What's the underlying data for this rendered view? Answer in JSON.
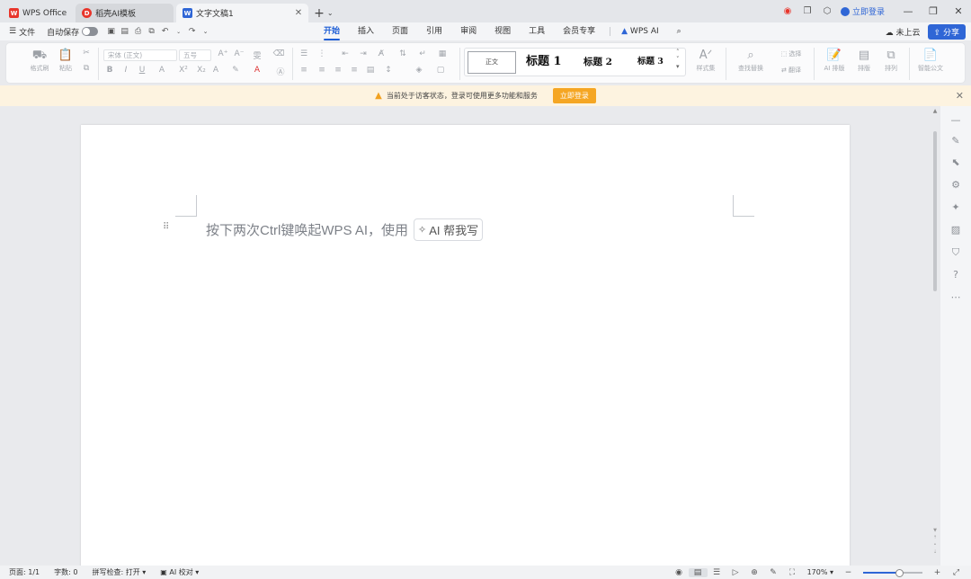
{
  "titlebar": {
    "tabs": [
      {
        "label": "WPS Office",
        "icon": "wps-logo-icon"
      },
      {
        "label": "稻壳AI模板",
        "icon": "docer-icon"
      },
      {
        "label": "文字文稿1",
        "icon": "word-doc-icon"
      }
    ],
    "new_tab": "+",
    "login_label": "立即登录"
  },
  "menu": {
    "file_label": "文件",
    "autosave_label": "自动保存",
    "tabs": [
      "开始",
      "插入",
      "页面",
      "引用",
      "审阅",
      "视图",
      "工具",
      "会员专享",
      "WPS AI"
    ],
    "active_tab": "开始",
    "cloud_label": "未上云",
    "share_label": "分享"
  },
  "ribbon": {
    "format_painter": "格式刷",
    "paste": "粘贴",
    "font_name": "宋体 (正文)",
    "font_size": "五号",
    "styles": [
      "正文",
      "标题 1",
      "标题 2",
      "标题 3"
    ],
    "style_set": "样式集",
    "find_replace": "查找替换",
    "select": "选择",
    "translate": "翻译",
    "ai_layout": "AI 排版",
    "layout": "排版",
    "arrange": "排列",
    "smart_doc": "智能公文"
  },
  "notice": {
    "message": "当前处于访客状态，登录可使用更多功能和服务",
    "button": "立即登录"
  },
  "document": {
    "prompt_text": "按下两次Ctrl键唤起WPS AI，使用",
    "ai_chip": "AI 帮我写"
  },
  "status": {
    "page": "页面: 1/1",
    "words": "字数: 0",
    "spell": "拼写检查: 打开",
    "ai_proof": "AI 校对",
    "zoom": "170%"
  },
  "colors": {
    "accent": "#2f66d6",
    "notice_bg": "#fdf3e0",
    "notice_button": "#f5a623"
  }
}
